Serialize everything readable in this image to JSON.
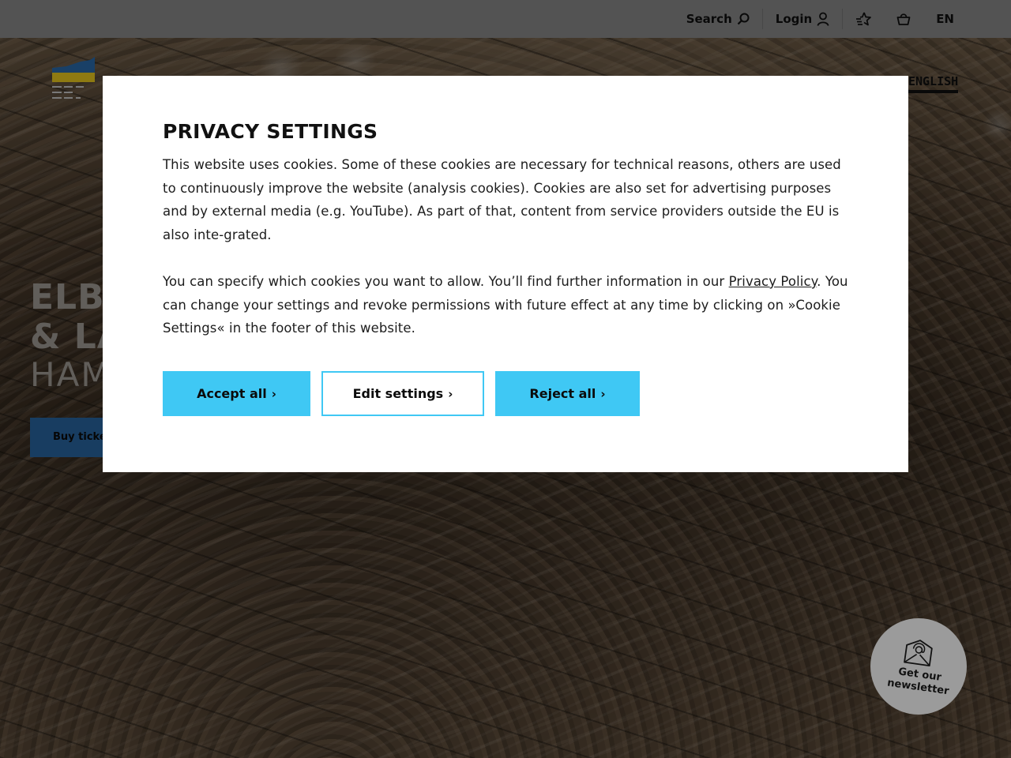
{
  "topbar": {
    "search_label": "Search",
    "login_label": "Login",
    "language_label": "EN"
  },
  "hero": {
    "language_link": "ENGLISH",
    "title_line1": "ELBPHILHARMONIE",
    "title_line2": "& LAEISZHALLE",
    "subtitle": "HAMBURG",
    "buy_tickets_label": "Buy tickets"
  },
  "modal": {
    "title": "PRIVACY SETTINGS",
    "paragraph1": "This website uses cookies. Some of these cookies are necessary for technical reasons, others are used to continuously improve the website (analysis cookies). Cookies are also set for advertising purposes and by external media (e.g. YouTube). As part of that, content from service providers outside the EU is also inte-grated.",
    "paragraph2_before_link": "You can specify which cookies you want to allow. You’ll find further information in our ",
    "privacy_link": "Privacy Policy",
    "paragraph2_after_link": ". You can change your settings and revoke permissions with future effect at any time by clicking on »Cookie Settings« in the footer of this website.",
    "accept_label": "Accept all",
    "edit_label": "Edit settings",
    "reject_label": "Reject all",
    "chevron": "›"
  },
  "newsletter": {
    "line1": "Get our",
    "line2": "newsletter"
  },
  "colors": {
    "accent": "#3fc8f4",
    "topbar": "#8f8f8f",
    "modal_bg": "#ffffff"
  }
}
